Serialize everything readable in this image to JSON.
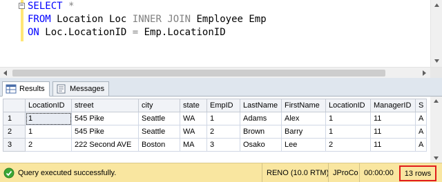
{
  "editor": {
    "collapse_symbol": "−",
    "line1": {
      "select": "SELECT",
      "star": "*"
    },
    "line2": {
      "from": "FROM",
      "table1": "Location",
      "alias1": "Loc",
      "join": "INNER JOIN",
      "table2": "Employee",
      "alias2": "Emp"
    },
    "line3": {
      "on": "ON",
      "left": "Loc.LocationID",
      "eq": "=",
      "right": "Emp.LocationID"
    }
  },
  "tabs": [
    {
      "label": "Results",
      "icon": "grid-icon",
      "active": true
    },
    {
      "label": "Messages",
      "icon": "messages-icon",
      "active": false
    }
  ],
  "grid": {
    "columns": [
      "LocationID",
      "street",
      "city",
      "state",
      "EmpID",
      "LastName",
      "FirstName",
      "LocationID",
      "ManagerID",
      "S"
    ],
    "rows": [
      {
        "num": "1",
        "cells": [
          "1",
          "545 Pike",
          "Seattle",
          "WA",
          "1",
          "Adams",
          "Alex",
          "1",
          "11",
          "A"
        ]
      },
      {
        "num": "2",
        "cells": [
          "1",
          "545 Pike",
          "Seattle",
          "WA",
          "2",
          "Brown",
          "Barry",
          "1",
          "11",
          "A"
        ]
      },
      {
        "num": "3",
        "cells": [
          "2",
          "222 Second AVE",
          "Boston",
          "MA",
          "3",
          "Osako",
          "Lee",
          "2",
          "11",
          "A"
        ]
      }
    ]
  },
  "status": {
    "message": "Query executed successfully.",
    "server": "RENO (10.0 RTM)",
    "user": "JProCo",
    "elapsed": "00:00:00",
    "row_count": "13 rows",
    "colors": {
      "bar": "#f9e6a0",
      "highlight": "#e11b1b",
      "ok_icon": "#3aa635"
    }
  }
}
